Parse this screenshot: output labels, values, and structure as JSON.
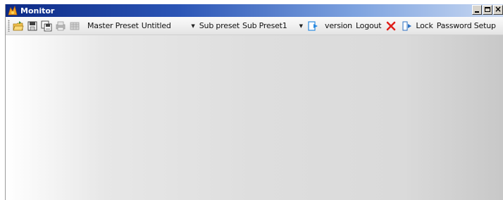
{
  "window": {
    "title": "Monitor",
    "controls": {
      "minimize": "minimize-icon",
      "maximize": "maximize-icon",
      "close": "close-icon"
    }
  },
  "toolbar": {
    "icons": [
      "open-folder-icon",
      "save-icon",
      "save-all-icon",
      "print-disabled-icon",
      "grid-disabled-icon"
    ],
    "master_preset_label": "Master Preset",
    "master_preset_value": "Untitled",
    "sub_preset_label": "Sub preset",
    "sub_preset_value": "Sub Preset1",
    "version_label": "version",
    "logout_label": "Logout",
    "lock_label": "Lock",
    "password_setup_label": "Password Setup"
  },
  "colors": {
    "titlebar_start": "#0c2a86",
    "titlebar_end": "#c9d9f2",
    "close_red": "#e0201b",
    "logout_blue": "#2a8ae0"
  }
}
